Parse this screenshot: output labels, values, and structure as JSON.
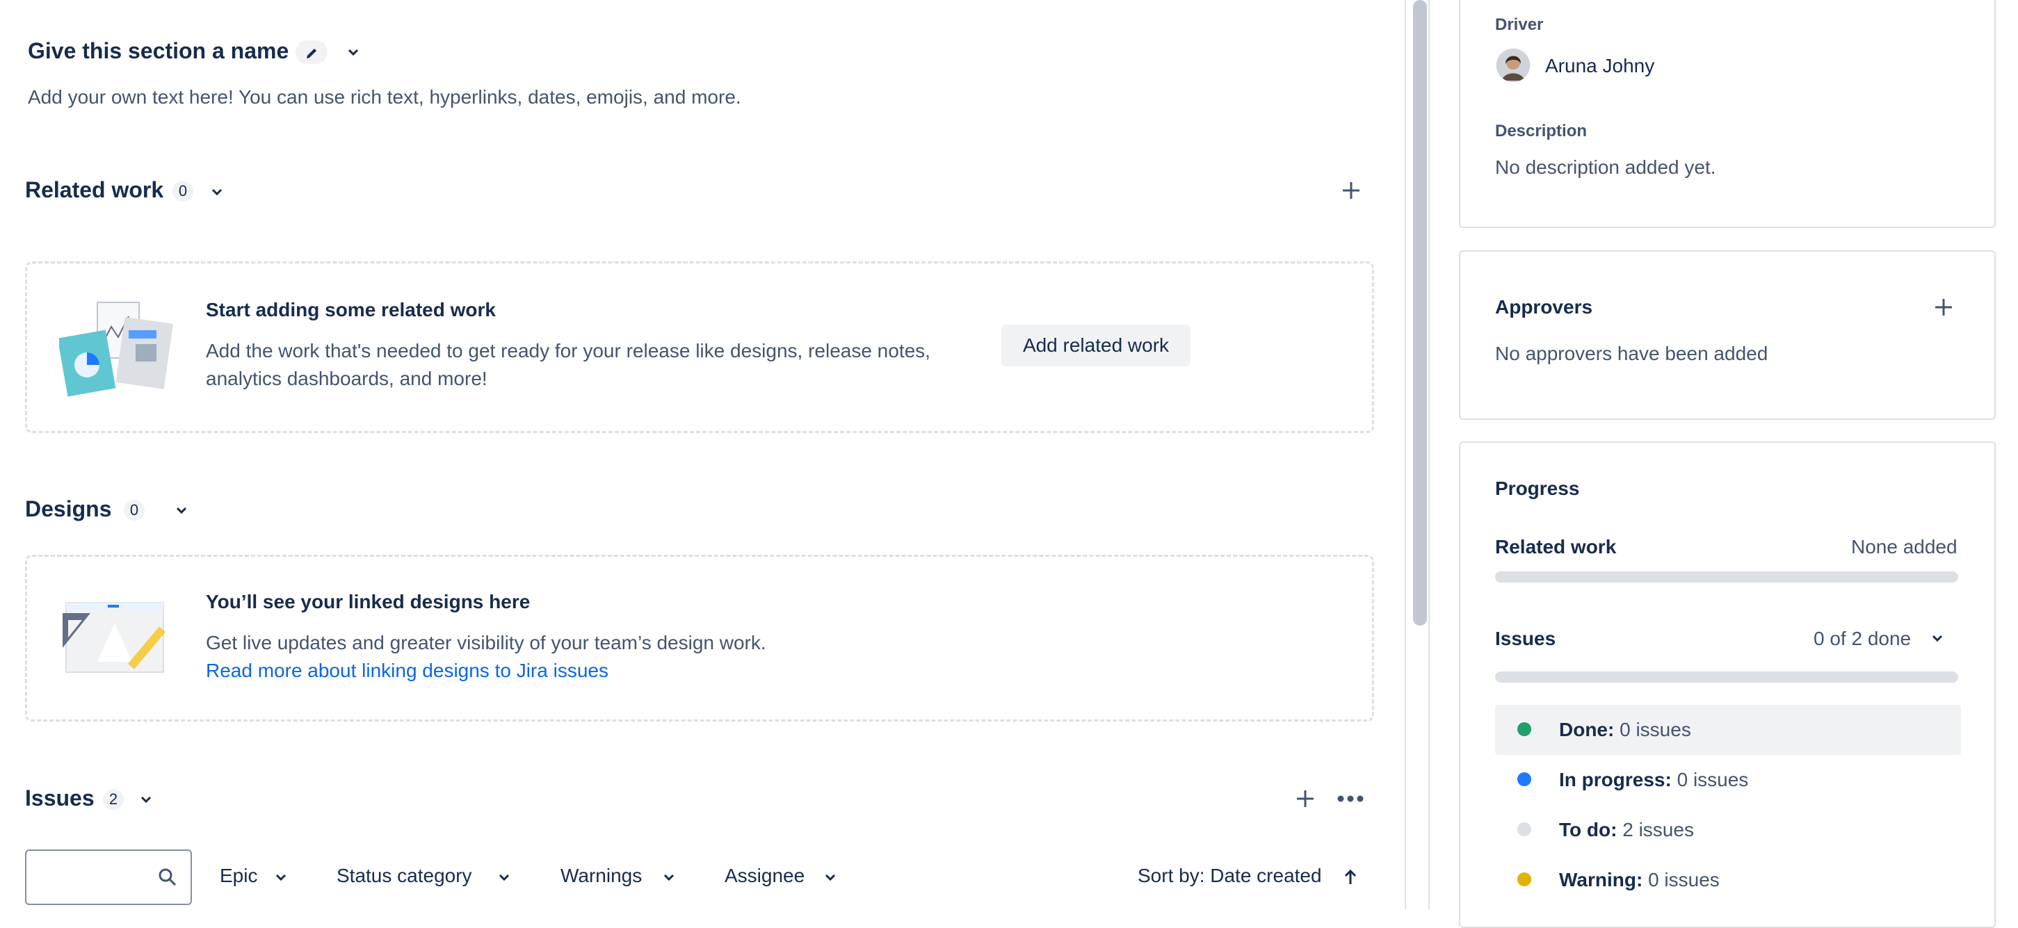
{
  "section": {
    "title": "Give this section a name",
    "description": "Add your own text here! You can use rich text, hyperlinks, dates, emojis, and more."
  },
  "related_work": {
    "title": "Related work",
    "count": "0",
    "empty_title": "Start adding some related work",
    "empty_line1": "Add the work that's needed to get ready for your release like designs, release notes,",
    "empty_line2": "analytics dashboards, and more!",
    "add_button": "Add related work"
  },
  "designs": {
    "title": "Designs",
    "count": "0",
    "empty_title": "You’ll see your linked designs here",
    "empty_text": "Get live updates and greater visibility of your team’s design work.",
    "link_text": "Read more about linking designs to Jira issues"
  },
  "issues": {
    "title": "Issues",
    "count": "2",
    "filters": [
      "Epic",
      "Status category",
      "Warnings",
      "Assignee"
    ],
    "sort_label": "Sort by: Date created"
  },
  "sidebar": {
    "driver_label": "Driver",
    "driver_name": "Aruna Johny",
    "description_label": "Description",
    "description_value": "No description added yet.",
    "approvers_title": "Approvers",
    "approvers_empty": "No approvers have been added",
    "progress_title": "Progress",
    "related_work_label": "Related work",
    "related_work_value": "None added",
    "issues_label": "Issues",
    "issues_value": "0 of 2 done",
    "progress_related_fraction": 0,
    "progress_issues_fraction": 0,
    "statuses": [
      {
        "label": "Done:",
        "value": "0 issues",
        "color": "#22a06b"
      },
      {
        "label": "In progress:",
        "value": "0 issues",
        "color": "#1d7afc"
      },
      {
        "label": "To do:",
        "value": "2 issues",
        "color": "#dcdfe4"
      },
      {
        "label": "Warning:",
        "value": "0 issues",
        "color": "#e2b203"
      }
    ]
  }
}
